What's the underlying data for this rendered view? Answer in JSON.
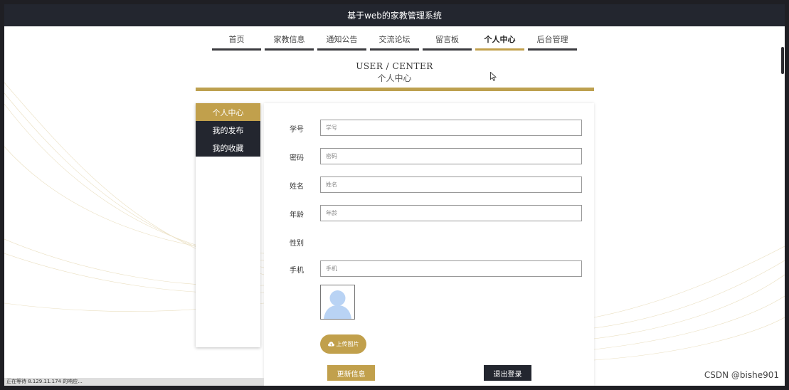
{
  "app": {
    "title": "基于web的家教管理系统"
  },
  "nav": {
    "items": [
      {
        "label": "首页"
      },
      {
        "label": "家教信息"
      },
      {
        "label": "通知公告"
      },
      {
        "label": "交流论坛"
      },
      {
        "label": "留言板"
      },
      {
        "label": "个人中心",
        "active": true
      },
      {
        "label": "后台管理"
      }
    ]
  },
  "heading": {
    "en": "USER / CENTER",
    "cn": "个人中心"
  },
  "sidebar": {
    "items": [
      {
        "label": "个人中心",
        "active": true
      },
      {
        "label": "我的发布"
      },
      {
        "label": "我的收藏"
      }
    ]
  },
  "form": {
    "student_id": {
      "label": "学号",
      "placeholder": "学号",
      "value": ""
    },
    "password": {
      "label": "密码",
      "placeholder": "密码",
      "value": ""
    },
    "name": {
      "label": "姓名",
      "placeholder": "姓名",
      "value": ""
    },
    "age": {
      "label": "年龄",
      "placeholder": "年龄",
      "value": ""
    },
    "gender": {
      "label": "性别"
    },
    "phone": {
      "label": "手机",
      "placeholder": "手机",
      "value": ""
    },
    "upload_label": "上传图片",
    "update_label": "更新信息",
    "logout_label": "退出登录"
  },
  "statusbar": {
    "text": "正在等待 8.129.11.174 的响应..."
  },
  "watermark": "CSDN @bishe901",
  "colors": {
    "accent": "#c1a04c",
    "dark": "#23262f"
  }
}
